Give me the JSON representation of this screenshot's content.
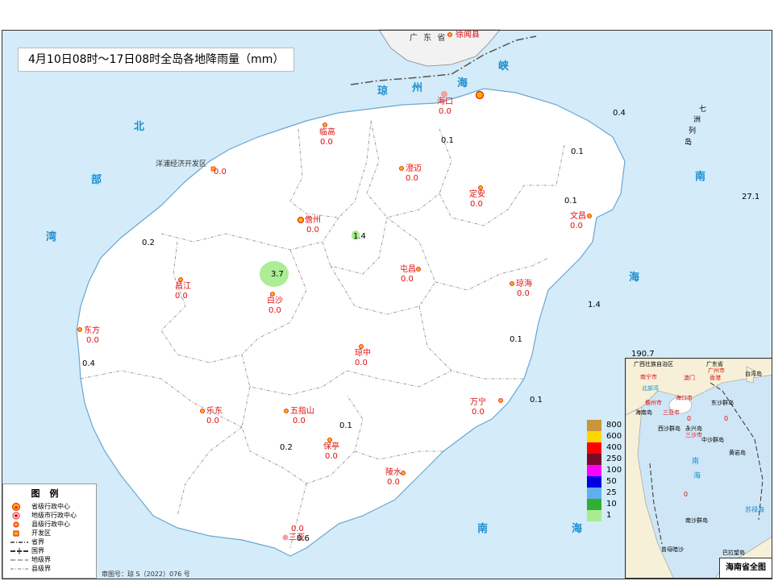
{
  "title": "4月10日08时～17日08时全岛各地降雨量（mm）",
  "approval": "审图号：琼 S（2022）076 号",
  "top_labels": {
    "guangdong": "广 东 省",
    "xuwen": "徐闻县"
  },
  "strait": [
    "琼",
    "州",
    "海",
    "峡"
  ],
  "seas": {
    "beibu": [
      "北",
      "部",
      "湾"
    ],
    "nanhai": [
      "南",
      "海"
    ],
    "nanhai_bottom": [
      "南",
      "海"
    ],
    "qizhou": [
      "七",
      "洲",
      "列",
      "岛"
    ]
  },
  "cities": [
    {
      "name": "海口",
      "value": "0.0"
    },
    {
      "name": "临高",
      "value": "0.0"
    },
    {
      "name": "澄迈",
      "value": "0.0"
    },
    {
      "name": "定安",
      "value": "0.0"
    },
    {
      "name": "文昌",
      "value": "0.0"
    },
    {
      "name": "儋州",
      "value": "0.0"
    },
    {
      "name": "洋浦经济开发区",
      "value": "0.0"
    },
    {
      "name": "屯昌",
      "value": "0.0"
    },
    {
      "name": "琼海",
      "value": "0.0"
    },
    {
      "name": "昌江",
      "value": "0.0"
    },
    {
      "name": "白沙",
      "value": "0.0"
    },
    {
      "name": "东方",
      "value": "0.0"
    },
    {
      "name": "琼中",
      "value": "0.0"
    },
    {
      "name": "乐东",
      "value": "0.0"
    },
    {
      "name": "五指山",
      "value": "0.0"
    },
    {
      "name": "万宁",
      "value": "0.0"
    },
    {
      "name": "保亭",
      "value": "0.0"
    },
    {
      "name": "陵水",
      "value": "0.0"
    },
    {
      "name": "三亚",
      "value": "0.0"
    }
  ],
  "station_values": [
    "0.4",
    "0.1",
    "0.1",
    "27.1",
    "0.2",
    "1.4",
    "3.7",
    "1.4",
    "0.1",
    "0.4",
    "190.7",
    "0.1",
    "0.1",
    "0.1",
    "0.2",
    "0.6"
  ],
  "scale": {
    "values": [
      "800",
      "600",
      "400",
      "250",
      "100",
      "50",
      "25",
      "10",
      "1"
    ],
    "colors": [
      "#c8963c",
      "#ffd700",
      "#ff0000",
      "#7a0a2a",
      "#ff00ff",
      "#0000e0",
      "#60b0f0",
      "#30b030",
      "#a8ec90"
    ]
  },
  "legend": {
    "title": "图例",
    "items": [
      "省级行政中心",
      "地级市行政中心",
      "县级行政中心",
      "开发区",
      "省界",
      "国界",
      "地级界",
      "县级界"
    ]
  },
  "inset": {
    "title": "海南省全图",
    "labels": [
      "广西壮族自治区",
      "广东省",
      "台湾岛",
      "南宁市",
      "广州市",
      "澳门",
      "香港",
      "北部湾",
      "海口市",
      "儋州市",
      "三亚市",
      "海南岛",
      "东沙群岛",
      "西沙群岛",
      "中沙群岛",
      "永兴岛",
      "三沙市",
      "黄岩岛",
      "南",
      "海",
      "南沙群岛",
      "曾母暗沙",
      "苏禄海",
      "巴拉望岛",
      "0",
      "0",
      "0"
    ]
  },
  "colors": {
    "sea": "#d4ebf9",
    "land": "#ffffff",
    "city_text": "#e01010",
    "sea_text": "#1a8fd0"
  }
}
